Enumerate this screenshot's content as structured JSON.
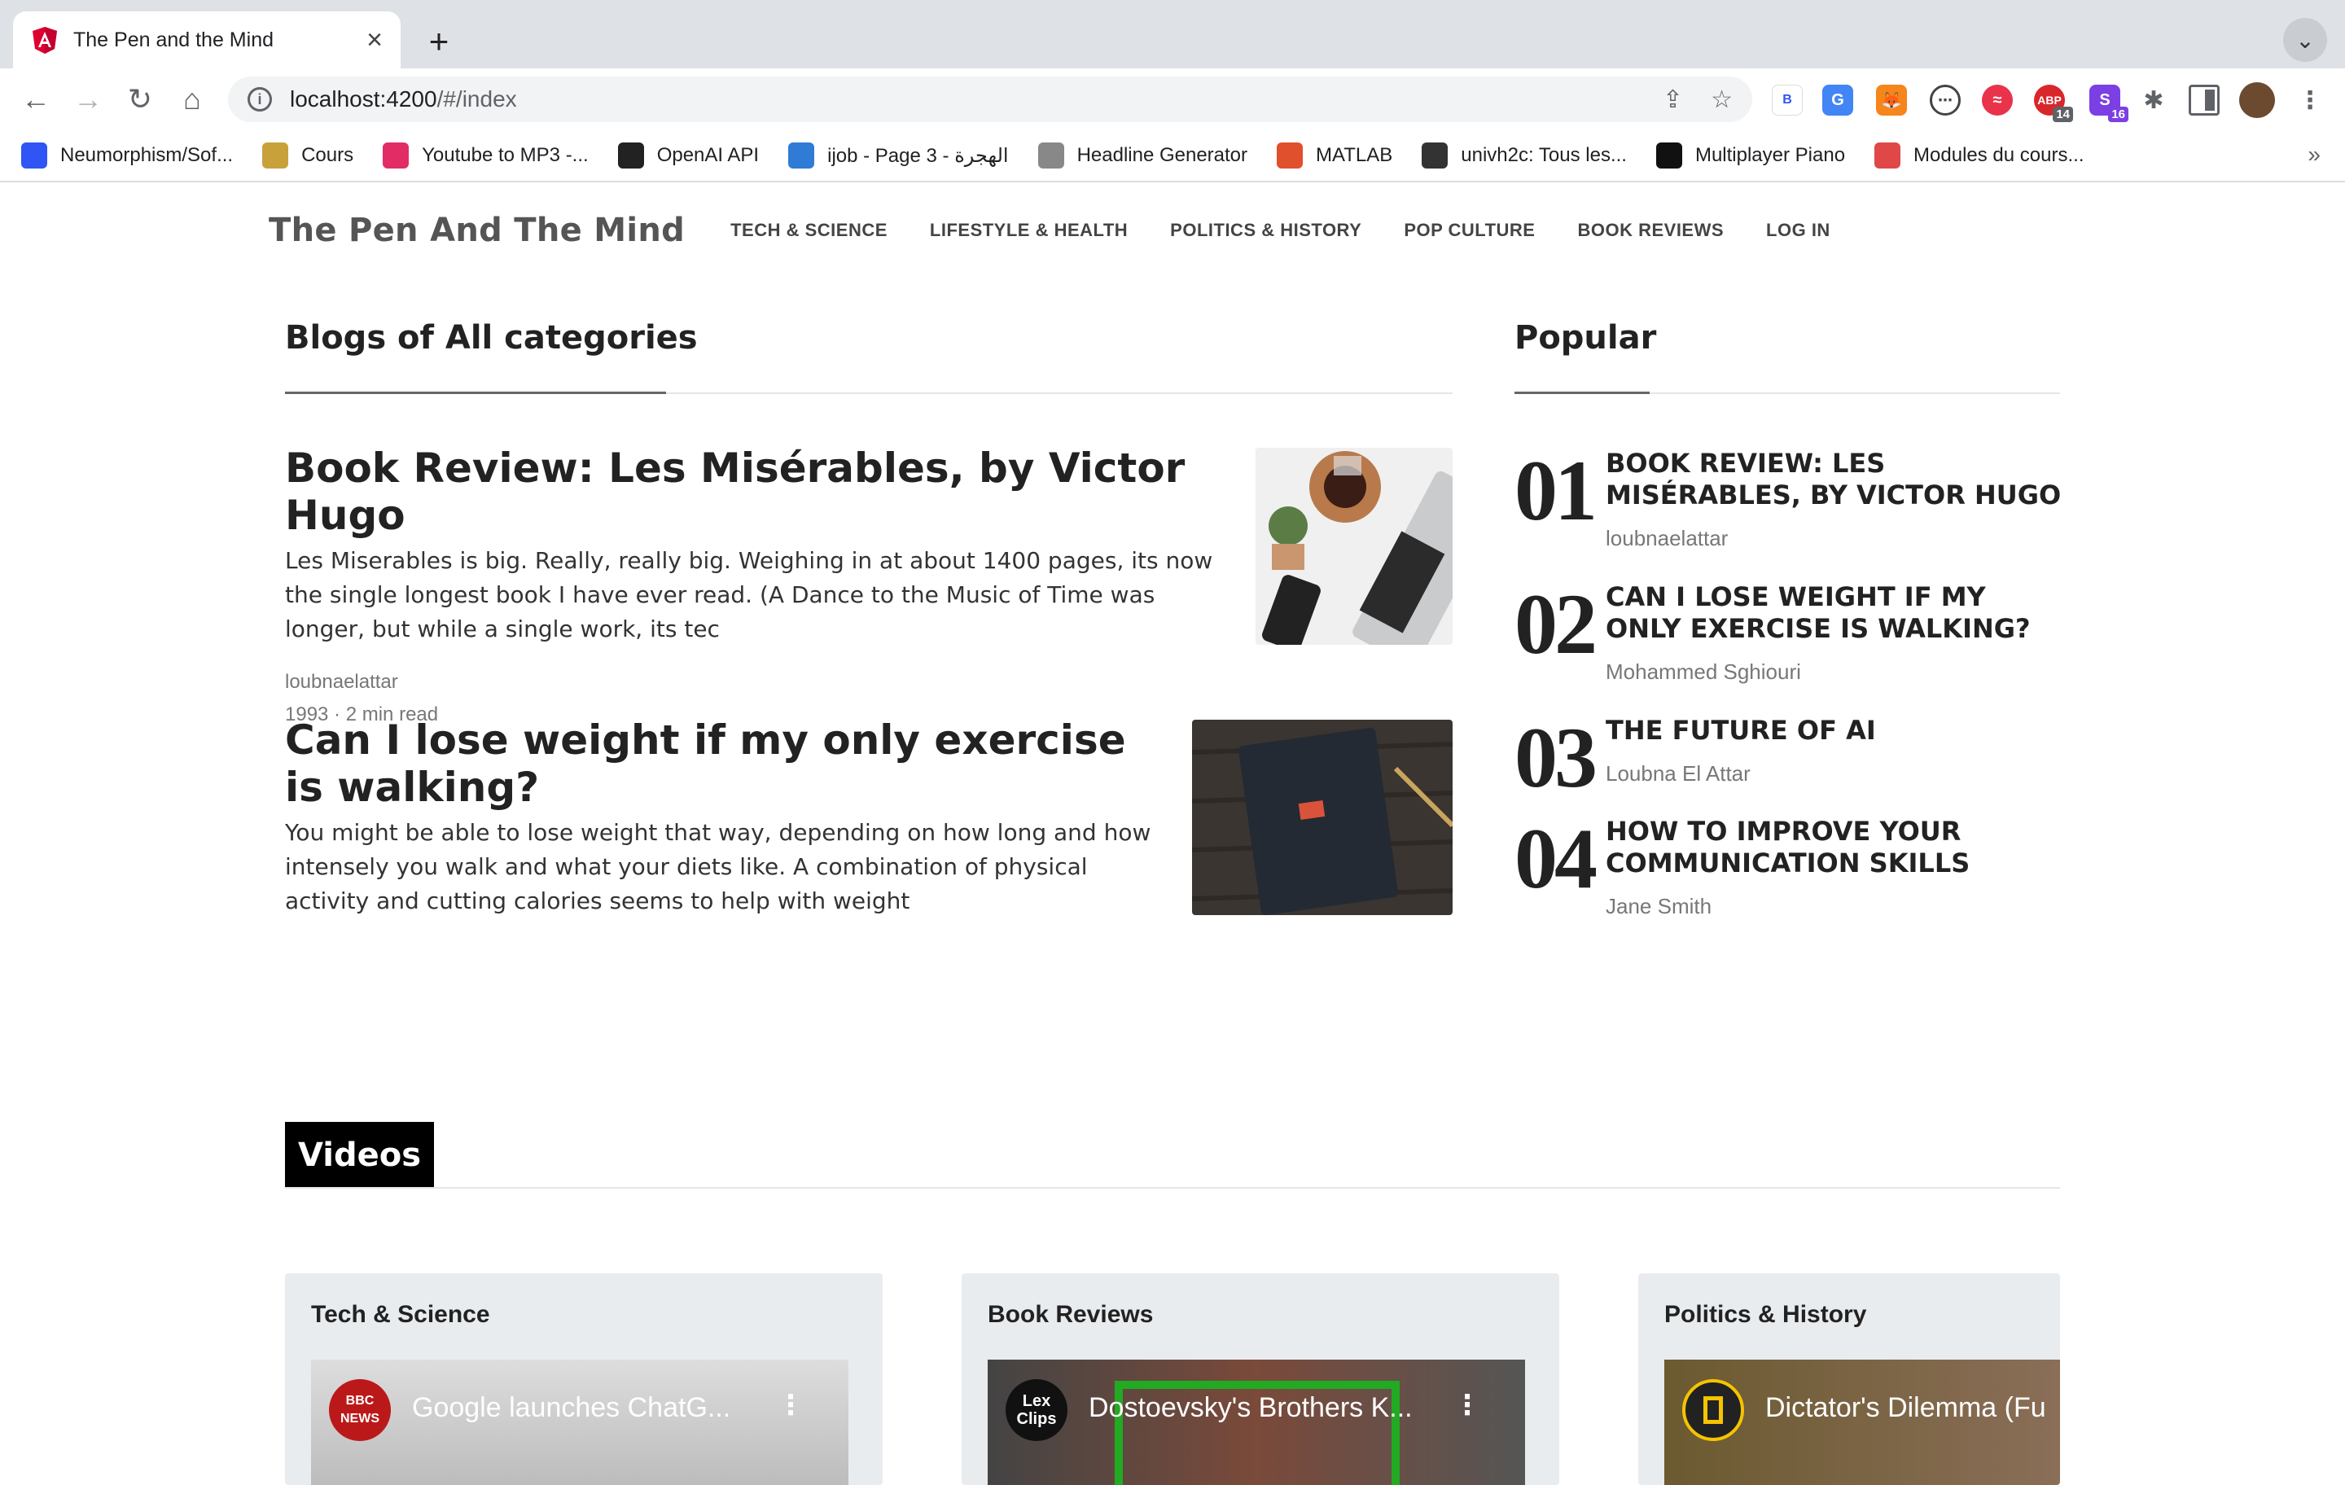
{
  "browser": {
    "tab_title": "The Pen and the Mind",
    "url_host": "localhost:4200",
    "url_path": "/#/index",
    "bookmarks": [
      {
        "label": "Neumorphism/Sof...",
        "color": "#2f55f5"
      },
      {
        "label": "Cours",
        "color": "#c8a13b"
      },
      {
        "label": "Youtube to MP3 -...",
        "color": "#e22c66"
      },
      {
        "label": "OpenAI API",
        "color": "#222222"
      },
      {
        "label": "ijob - Page 3 - الهجرة",
        "color": "#2f7bd6"
      },
      {
        "label": "Headline Generator",
        "color": "#888888"
      },
      {
        "label": "MATLAB",
        "color": "#e0502d"
      },
      {
        "label": "univh2c: Tous les...",
        "color": "#333333"
      },
      {
        "label": "Multiplayer Piano",
        "color": "#111111"
      },
      {
        "label": "Modules du cours...",
        "color": "#e04848"
      }
    ],
    "more_bookmarks": "»",
    "extension_badges": {
      "abp": "14",
      "s": "16"
    }
  },
  "site": {
    "brand": "The Pen And The Mind",
    "nav": [
      "TECH & SCIENCE",
      "LIFESTYLE & HEALTH",
      "POLITICS & HISTORY",
      "POP CULTURE",
      "BOOK REVIEWS",
      "LOG IN"
    ]
  },
  "blogs": {
    "heading": "Blogs of All categories",
    "posts": [
      {
        "title": "Book Review: Les Misérables, by Victor Hugo",
        "excerpt": "Les Miserables is big. Really, really big. Weighing in at about 1400 pages, its now the single longest book I have ever read. (A Dance to the Music of Time was longer, but while a single work, its tec",
        "author": "loubnaelattar",
        "meta": "1993 · 2 min read"
      },
      {
        "title": "Can I lose weight if my only exercise is walking?",
        "excerpt": "You might be able to lose weight that way, depending on how long and how intensely you walk and what your diets like. A combination of physical activity and cutting calories seems to help with weight"
      }
    ]
  },
  "popular": {
    "heading": "Popular",
    "items": [
      {
        "num": "01",
        "title": "BOOK REVIEW: LES MISÉRABLES, BY VICTOR HUGO",
        "author": "loubnaelattar"
      },
      {
        "num": "02",
        "title": "CAN I LOSE WEIGHT IF MY ONLY EXERCISE IS WALKING?",
        "author": "Mohammed Sghiouri"
      },
      {
        "num": "03",
        "title": "THE FUTURE OF AI",
        "author": "Loubna El Attar"
      },
      {
        "num": "04",
        "title": "HOW TO IMPROVE YOUR COMMUNICATION SKILLS",
        "author": "Jane Smith"
      }
    ]
  },
  "videos": {
    "heading": "Videos",
    "cards": [
      {
        "category": "Tech & Science",
        "video_title": "Google launches ChatG...",
        "channel": "BBC NEWS",
        "channel_color": "#bb1919"
      },
      {
        "category": "Book Reviews",
        "video_title": "Dostoevsky's Brothers K...",
        "channel": "Lex Clips",
        "channel_color": "#111111"
      },
      {
        "category": "Politics & History",
        "video_title": "Dictator's Dilemma (Fu",
        "channel": "",
        "channel_color": "#f5c400"
      }
    ]
  }
}
